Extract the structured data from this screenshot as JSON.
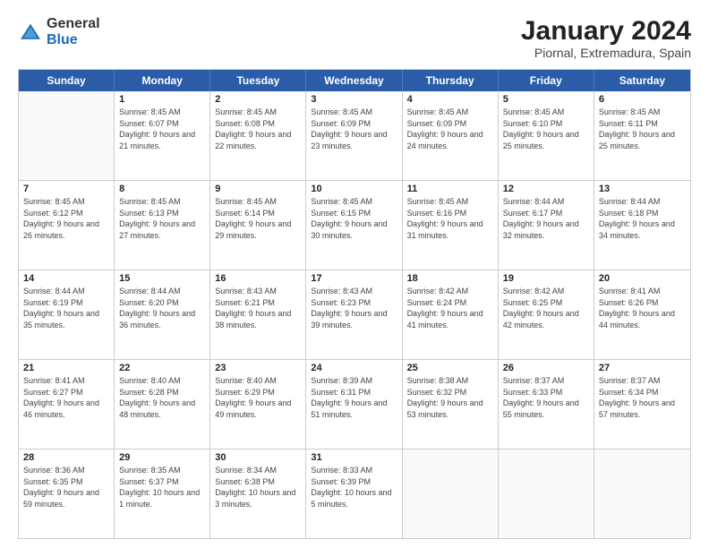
{
  "header": {
    "logo_general": "General",
    "logo_blue": "Blue",
    "title": "January 2024",
    "subtitle": "Piornal, Extremadura, Spain"
  },
  "days_of_week": [
    "Sunday",
    "Monday",
    "Tuesday",
    "Wednesday",
    "Thursday",
    "Friday",
    "Saturday"
  ],
  "weeks": [
    [
      {
        "day": null,
        "sunrise": null,
        "sunset": null,
        "daylight": null
      },
      {
        "day": "1",
        "sunrise": "Sunrise: 8:45 AM",
        "sunset": "Sunset: 6:07 PM",
        "daylight": "Daylight: 9 hours and 21 minutes."
      },
      {
        "day": "2",
        "sunrise": "Sunrise: 8:45 AM",
        "sunset": "Sunset: 6:08 PM",
        "daylight": "Daylight: 9 hours and 22 minutes."
      },
      {
        "day": "3",
        "sunrise": "Sunrise: 8:45 AM",
        "sunset": "Sunset: 6:09 PM",
        "daylight": "Daylight: 9 hours and 23 minutes."
      },
      {
        "day": "4",
        "sunrise": "Sunrise: 8:45 AM",
        "sunset": "Sunset: 6:09 PM",
        "daylight": "Daylight: 9 hours and 24 minutes."
      },
      {
        "day": "5",
        "sunrise": "Sunrise: 8:45 AM",
        "sunset": "Sunset: 6:10 PM",
        "daylight": "Daylight: 9 hours and 25 minutes."
      },
      {
        "day": "6",
        "sunrise": "Sunrise: 8:45 AM",
        "sunset": "Sunset: 6:11 PM",
        "daylight": "Daylight: 9 hours and 25 minutes."
      }
    ],
    [
      {
        "day": "7",
        "sunrise": "Sunrise: 8:45 AM",
        "sunset": "Sunset: 6:12 PM",
        "daylight": "Daylight: 9 hours and 26 minutes."
      },
      {
        "day": "8",
        "sunrise": "Sunrise: 8:45 AM",
        "sunset": "Sunset: 6:13 PM",
        "daylight": "Daylight: 9 hours and 27 minutes."
      },
      {
        "day": "9",
        "sunrise": "Sunrise: 8:45 AM",
        "sunset": "Sunset: 6:14 PM",
        "daylight": "Daylight: 9 hours and 29 minutes."
      },
      {
        "day": "10",
        "sunrise": "Sunrise: 8:45 AM",
        "sunset": "Sunset: 6:15 PM",
        "daylight": "Daylight: 9 hours and 30 minutes."
      },
      {
        "day": "11",
        "sunrise": "Sunrise: 8:45 AM",
        "sunset": "Sunset: 6:16 PM",
        "daylight": "Daylight: 9 hours and 31 minutes."
      },
      {
        "day": "12",
        "sunrise": "Sunrise: 8:44 AM",
        "sunset": "Sunset: 6:17 PM",
        "daylight": "Daylight: 9 hours and 32 minutes."
      },
      {
        "day": "13",
        "sunrise": "Sunrise: 8:44 AM",
        "sunset": "Sunset: 6:18 PM",
        "daylight": "Daylight: 9 hours and 34 minutes."
      }
    ],
    [
      {
        "day": "14",
        "sunrise": "Sunrise: 8:44 AM",
        "sunset": "Sunset: 6:19 PM",
        "daylight": "Daylight: 9 hours and 35 minutes."
      },
      {
        "day": "15",
        "sunrise": "Sunrise: 8:44 AM",
        "sunset": "Sunset: 6:20 PM",
        "daylight": "Daylight: 9 hours and 36 minutes."
      },
      {
        "day": "16",
        "sunrise": "Sunrise: 8:43 AM",
        "sunset": "Sunset: 6:21 PM",
        "daylight": "Daylight: 9 hours and 38 minutes."
      },
      {
        "day": "17",
        "sunrise": "Sunrise: 8:43 AM",
        "sunset": "Sunset: 6:23 PM",
        "daylight": "Daylight: 9 hours and 39 minutes."
      },
      {
        "day": "18",
        "sunrise": "Sunrise: 8:42 AM",
        "sunset": "Sunset: 6:24 PM",
        "daylight": "Daylight: 9 hours and 41 minutes."
      },
      {
        "day": "19",
        "sunrise": "Sunrise: 8:42 AM",
        "sunset": "Sunset: 6:25 PM",
        "daylight": "Daylight: 9 hours and 42 minutes."
      },
      {
        "day": "20",
        "sunrise": "Sunrise: 8:41 AM",
        "sunset": "Sunset: 6:26 PM",
        "daylight": "Daylight: 9 hours and 44 minutes."
      }
    ],
    [
      {
        "day": "21",
        "sunrise": "Sunrise: 8:41 AM",
        "sunset": "Sunset: 6:27 PM",
        "daylight": "Daylight: 9 hours and 46 minutes."
      },
      {
        "day": "22",
        "sunrise": "Sunrise: 8:40 AM",
        "sunset": "Sunset: 6:28 PM",
        "daylight": "Daylight: 9 hours and 48 minutes."
      },
      {
        "day": "23",
        "sunrise": "Sunrise: 8:40 AM",
        "sunset": "Sunset: 6:29 PM",
        "daylight": "Daylight: 9 hours and 49 minutes."
      },
      {
        "day": "24",
        "sunrise": "Sunrise: 8:39 AM",
        "sunset": "Sunset: 6:31 PM",
        "daylight": "Daylight: 9 hours and 51 minutes."
      },
      {
        "day": "25",
        "sunrise": "Sunrise: 8:38 AM",
        "sunset": "Sunset: 6:32 PM",
        "daylight": "Daylight: 9 hours and 53 minutes."
      },
      {
        "day": "26",
        "sunrise": "Sunrise: 8:37 AM",
        "sunset": "Sunset: 6:33 PM",
        "daylight": "Daylight: 9 hours and 55 minutes."
      },
      {
        "day": "27",
        "sunrise": "Sunrise: 8:37 AM",
        "sunset": "Sunset: 6:34 PM",
        "daylight": "Daylight: 9 hours and 57 minutes."
      }
    ],
    [
      {
        "day": "28",
        "sunrise": "Sunrise: 8:36 AM",
        "sunset": "Sunset: 6:35 PM",
        "daylight": "Daylight: 9 hours and 59 minutes."
      },
      {
        "day": "29",
        "sunrise": "Sunrise: 8:35 AM",
        "sunset": "Sunset: 6:37 PM",
        "daylight": "Daylight: 10 hours and 1 minute."
      },
      {
        "day": "30",
        "sunrise": "Sunrise: 8:34 AM",
        "sunset": "Sunset: 6:38 PM",
        "daylight": "Daylight: 10 hours and 3 minutes."
      },
      {
        "day": "31",
        "sunrise": "Sunrise: 8:33 AM",
        "sunset": "Sunset: 6:39 PM",
        "daylight": "Daylight: 10 hours and 5 minutes."
      },
      {
        "day": null,
        "sunrise": null,
        "sunset": null,
        "daylight": null
      },
      {
        "day": null,
        "sunrise": null,
        "sunset": null,
        "daylight": null
      },
      {
        "day": null,
        "sunrise": null,
        "sunset": null,
        "daylight": null
      }
    ]
  ]
}
